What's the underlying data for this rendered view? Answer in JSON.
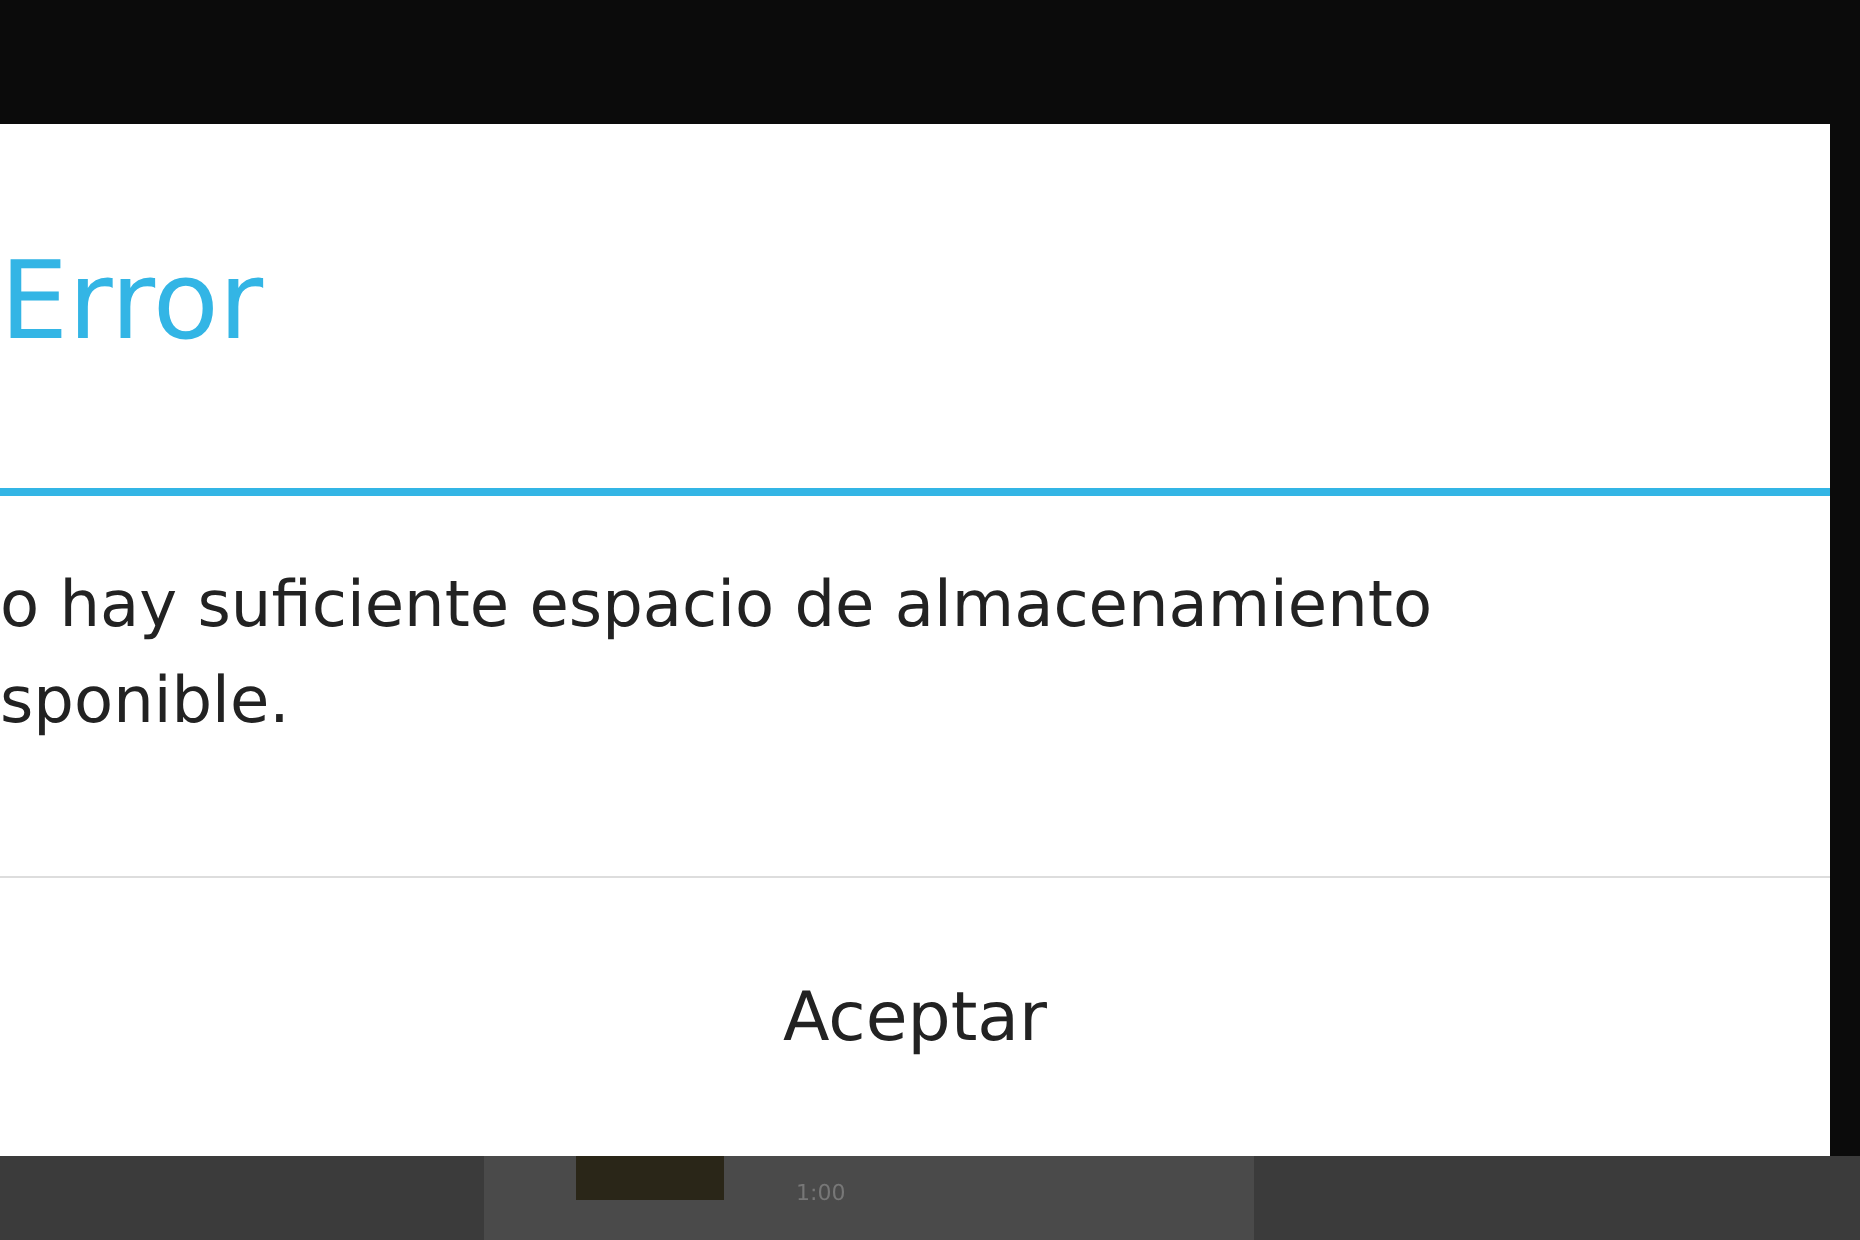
{
  "dialog": {
    "title": "Error",
    "message_lines": [
      "o hay suficiente espacio de almacenamiento",
      "sponible."
    ],
    "buttons": [
      "Aceptar"
    ]
  },
  "background": {
    "duration": "1:00"
  }
}
